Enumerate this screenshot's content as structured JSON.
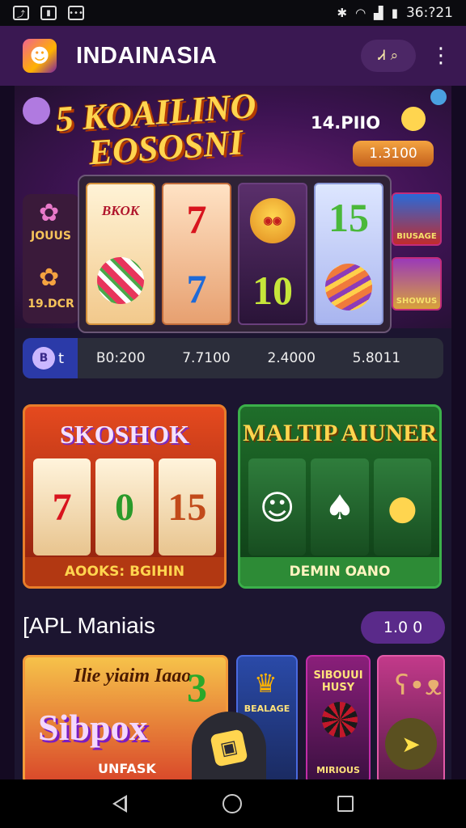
{
  "status_bar": {
    "time": "36:?21",
    "icons": [
      "chart-icon",
      "battery-saver-icon",
      "notification-icon",
      "bluetooth-icon",
      "wifi-icon",
      "signal-icon",
      "battery-icon"
    ]
  },
  "app_bar": {
    "title": "INDAINASIA",
    "search_glyph": "Ꮧ"
  },
  "hero": {
    "title_line1": "5 KOAILINO",
    "title_line2": "EOSOSNI",
    "amount": "14.PIIO",
    "pill": "1.3100",
    "side_top_label": "JOUUS",
    "side_bottom_label": "19.DCR",
    "reel_labels": [
      "BKOK",
      "7",
      "10",
      "15"
    ],
    "right_thumb_labels": [
      "BIUSAGE",
      "SHOWUS"
    ]
  },
  "info_bar": {
    "toggle_letter": "B",
    "toggle_t": "t",
    "values": [
      "B0:200",
      "7.7100",
      "2.4000",
      "5.8011"
    ]
  },
  "cards": [
    {
      "title": "SKOSHOK",
      "caption": "AOOKS: BGIHIN",
      "art": [
        "7",
        "0",
        "15"
      ]
    },
    {
      "title": "MALTIP AIUNER",
      "caption": "DEMIN OANO"
    }
  ],
  "section": {
    "title": "[APL Maniais",
    "pill": "1.0 0"
  },
  "tiles": [
    {
      "sub": "Ilie yiaim Iaao",
      "title": "Sibpox",
      "corner": "3",
      "bottom": "UNFASK"
    },
    {
      "label": "BEALAGE"
    },
    {
      "label": "SIBOUUI HUSY",
      "bottom": "MIRIOUS"
    },
    {
      "label": ""
    }
  ],
  "colors": {
    "app_bar": "#3a1852",
    "accent_gold": "#ffd54f",
    "accent_purple": "#5a2a8a",
    "card_left_border": "#e87d2a",
    "card_right_border": "#3bb04a"
  }
}
